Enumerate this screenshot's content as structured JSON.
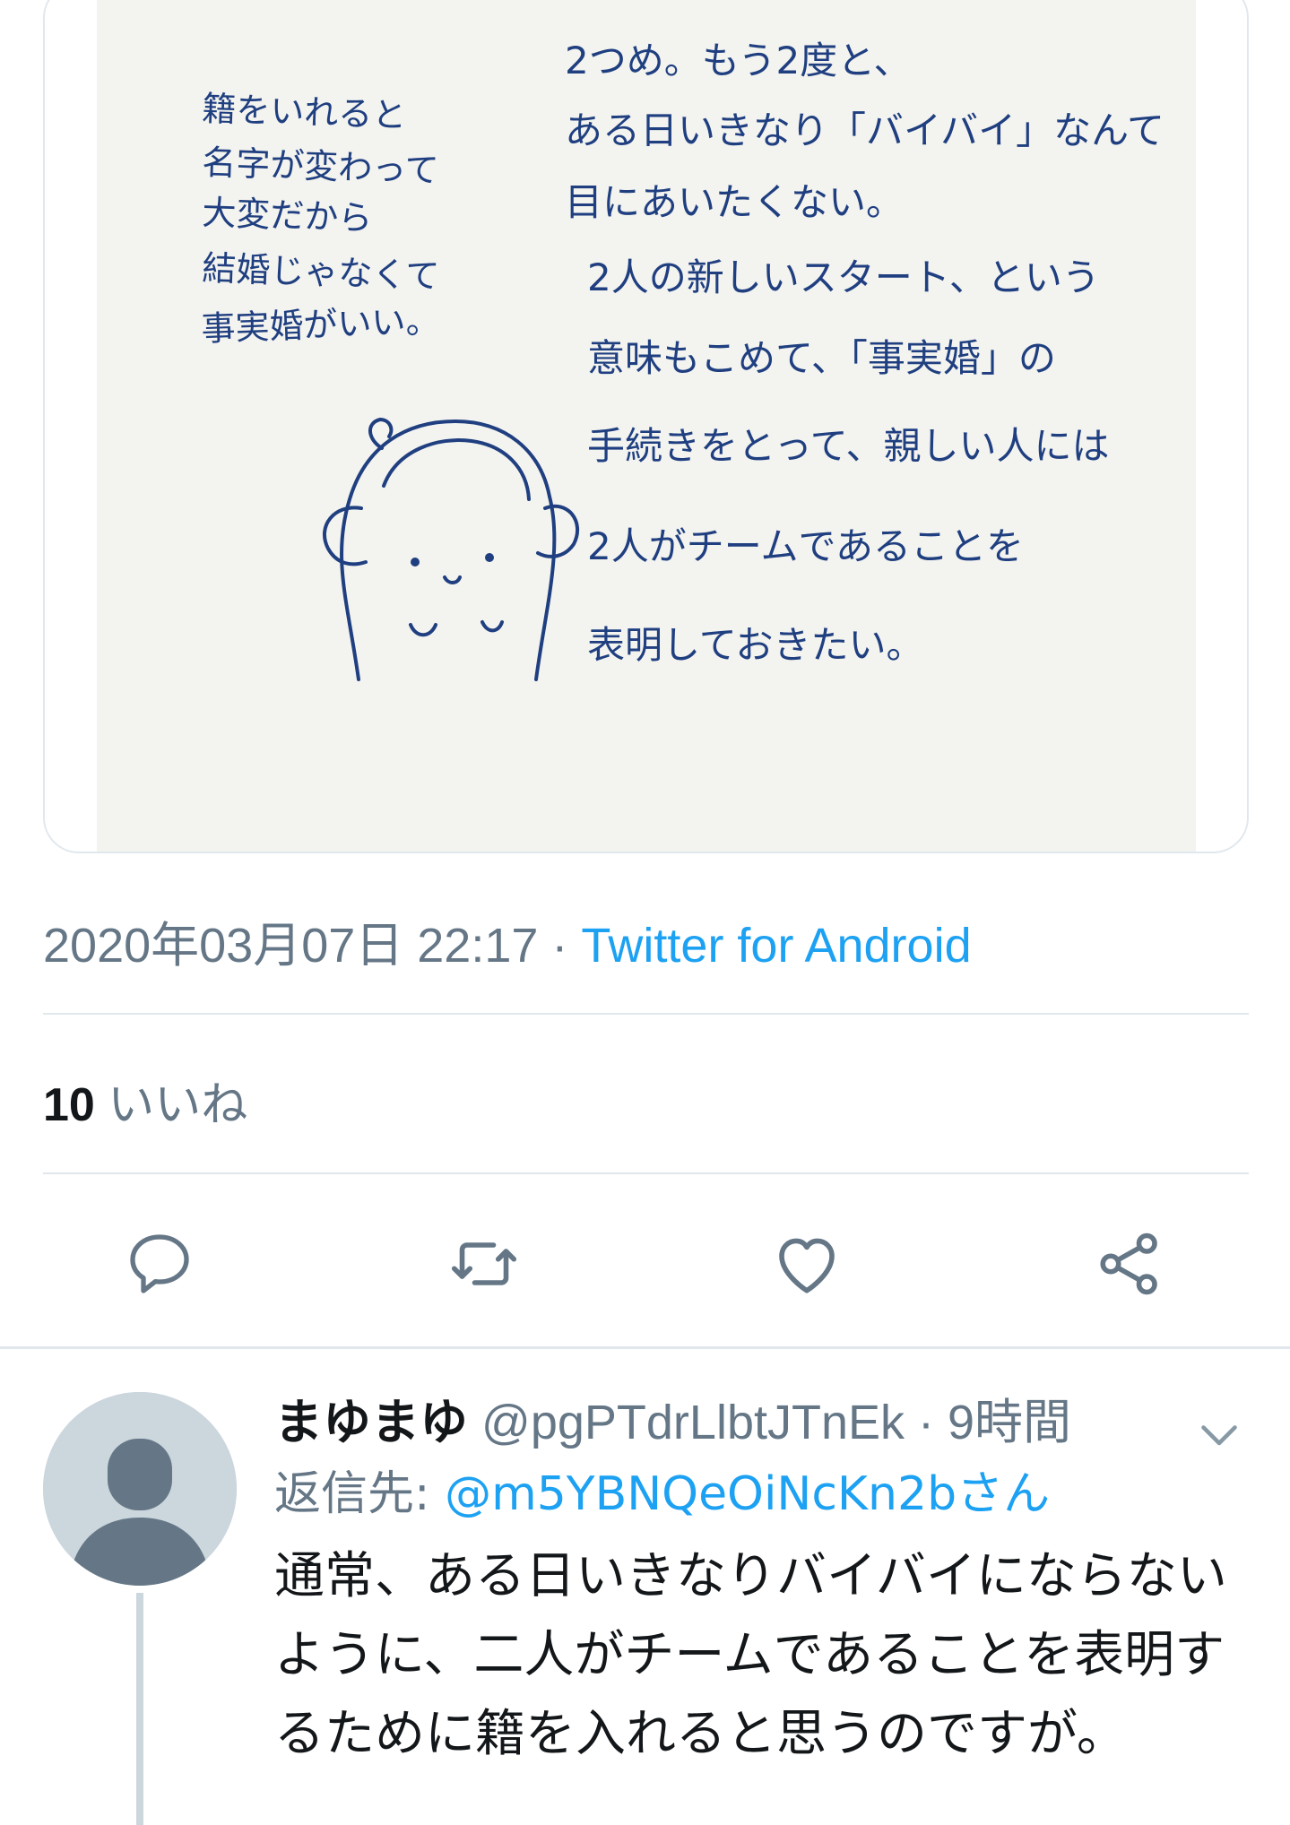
{
  "media": {
    "left_text": [
      "籍をいれると",
      "名字が変わって",
      "大変だから",
      "結婚じゃなくて",
      "事実婚がいい。"
    ],
    "right_text": [
      "2つめ。もう2度と、",
      "ある日いきなり「バイバイ」なんて",
      "目にあいたくない。",
      "2人の新しいスタート、という",
      "意味もこめて、「事実婚」の",
      "手続きをとって、親しい人には",
      "2人がチームであることを",
      "表明しておきたい。"
    ]
  },
  "tweet": {
    "timestamp": "2020年03月07日 22:17",
    "separator": " · ",
    "source": "Twitter for Android",
    "likes_count": "10",
    "likes_label": " いいね"
  },
  "actions": {
    "icons": [
      "reply-icon",
      "retweet-icon",
      "like-icon",
      "share-icon"
    ],
    "color": "#657786"
  },
  "reply": {
    "name": "まゆまゆ",
    "handle": "@pgPTdrLlbtJTnEk",
    "dot": " · ",
    "time": "9時間",
    "reply_prefix": "返信先: ",
    "reply_target": "@m5YBNQeOiNcKn2bさん",
    "text": "通常、ある日いきなりバイバイにならないように、二人がチームであることを表明するために籍を入れると思うのですが。"
  },
  "colors": {
    "accent": "#1da1f2",
    "muted": "#657786",
    "divider": "#e1e8ed",
    "handwriting": "#1f3f80"
  }
}
